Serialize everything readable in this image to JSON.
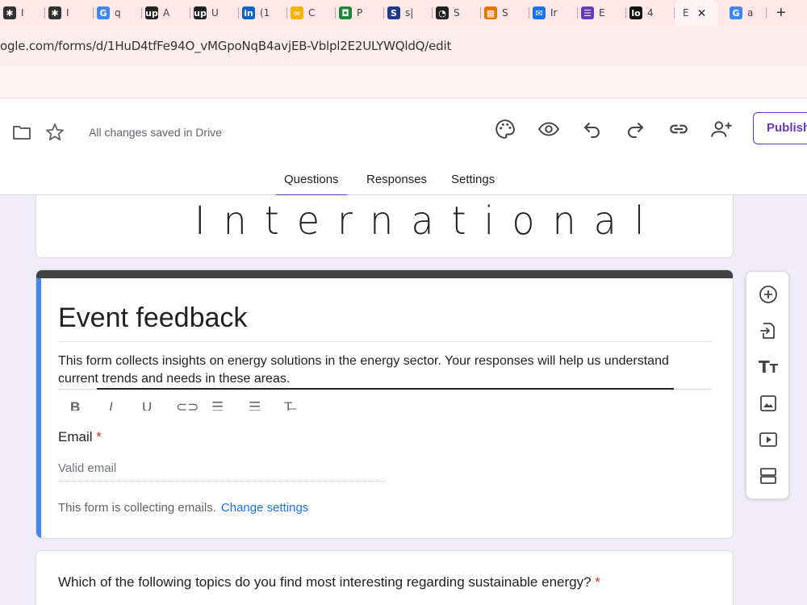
{
  "browser": {
    "tabs": [
      {
        "label": "I",
        "icon": "spider-icon",
        "color": "#333333",
        "glyph": "✱"
      },
      {
        "label": "I",
        "icon": "spider-icon",
        "color": "#333333",
        "glyph": "✱"
      },
      {
        "label": "q",
        "icon": "google-icon",
        "color": "#4285f4",
        "glyph": "G"
      },
      {
        "label": "A",
        "icon": "upwork-icon",
        "color": "#222222",
        "glyph": "up"
      },
      {
        "label": "U",
        "icon": "upwork-icon",
        "color": "#222222",
        "glyph": "up"
      },
      {
        "label": "(1",
        "icon": "linkedin-icon",
        "color": "#0a66c2",
        "glyph": "in"
      },
      {
        "label": "C",
        "icon": "link-icon",
        "color": "#f4b400",
        "glyph": "∞"
      },
      {
        "label": "P",
        "icon": "robot-icon",
        "color": "#1b8a3a",
        "glyph": "◘"
      },
      {
        "label": "s|",
        "icon": "s-icon",
        "color": "#1e3a8a",
        "glyph": "S"
      },
      {
        "label": "S",
        "icon": "gauge-icon",
        "color": "#222222",
        "glyph": "◔"
      },
      {
        "label": "S",
        "icon": "grid-icon",
        "color": "#e37400",
        "glyph": "▦"
      },
      {
        "label": "Ir",
        "icon": "mail-icon",
        "color": "#1a73e8",
        "glyph": "✉"
      },
      {
        "label": "E",
        "icon": "forms-icon",
        "color": "#673ab7",
        "glyph": "☰"
      },
      {
        "label": "4",
        "icon": "lo-icon",
        "color": "#111111",
        "glyph": "lo"
      }
    ],
    "active_tab_label": "E",
    "last_tab": {
      "label": "a",
      "icon": "google-icon",
      "glyph": "G"
    },
    "url": "ogle.com/forms/d/1HuD4tfFe94O_vMGpoNqB4avjEB-Vblpl2E2ULYWQldQ/edit"
  },
  "header": {
    "saved_text": "All changes saved in Drive",
    "publish_label": "Publish",
    "tabs": [
      "Questions",
      "Responses",
      "Settings"
    ],
    "active_tab": "Questions"
  },
  "banner": {
    "text": "International"
  },
  "form": {
    "title": "Event feedback",
    "description": "This form collects insights on energy solutions in the energy sector. Your responses will help us understand current trends and needs in these areas.",
    "format_buttons": [
      "B",
      "I",
      "U",
      "link",
      "ordered-list",
      "bulleted-list",
      "clear"
    ],
    "email_label": "Email",
    "required_mark": "*",
    "email_placeholder": "Valid email",
    "collecting_text": "This form is collecting emails.",
    "change_settings": "Change settings"
  },
  "question": {
    "text": "Which of the following topics do you find most interesting regarding sustainable energy?",
    "required_mark": "*"
  },
  "colors": {
    "accent": "#673ab7",
    "left_bar": "#4285f4",
    "link": "#1a73e8"
  }
}
